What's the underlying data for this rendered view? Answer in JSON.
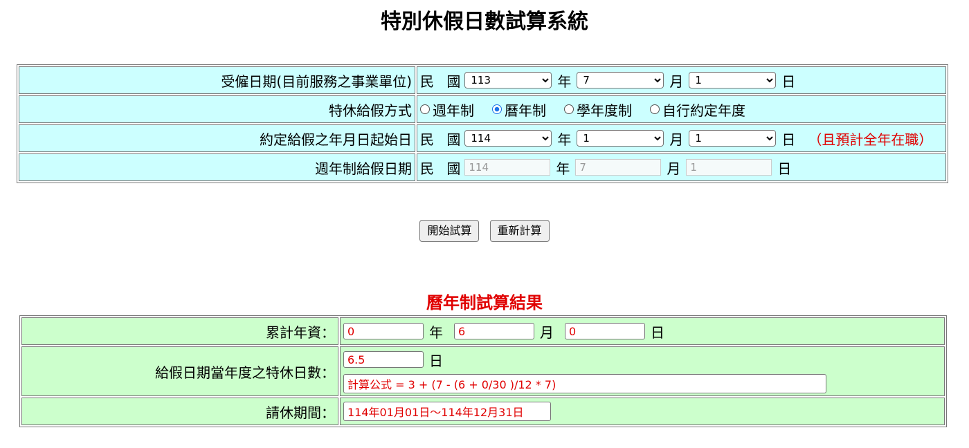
{
  "title": "特別休假日數試算系統",
  "form": {
    "hire_label": "受僱日期(目前服務之事業單位)",
    "hire_prefix": "民 國",
    "hire_year": "113",
    "hire_month": "7",
    "hire_day": "1",
    "unit_year": "年",
    "unit_month": "月",
    "unit_day": "日",
    "method_label": "特休給假方式",
    "methods": [
      "週年制",
      "曆年制",
      "學年度制",
      "自行約定年度"
    ],
    "selected_method": "曆年制",
    "agreed_label": "約定給假之年月日起始日",
    "agreed_prefix": "民 國",
    "agreed_year": "114",
    "agreed_month": "1",
    "agreed_day": "1",
    "agreed_note": "（且預計全年在職）",
    "anniv_label": "週年制給假日期",
    "anniv_prefix": "民 國",
    "anniv_year": "114",
    "anniv_month": "7",
    "anniv_day": "1"
  },
  "buttons": {
    "start": "開始試算",
    "reset": "重新計算"
  },
  "result": {
    "title": "曆年制試算結果",
    "seniority_label": "累計年資：",
    "years": "0",
    "months": "6",
    "days": "0",
    "unit_year": "年",
    "unit_month": "月",
    "unit_day": "日",
    "leave_label": "給假日期當年度之特休日數：",
    "leave_days": "6.5",
    "formula": "計算公式 = 3 + (7 - (6 + 0/30 )/12 * 7)",
    "period_label": "請休期間：",
    "period": "114年01月01日～114年12月31日"
  }
}
